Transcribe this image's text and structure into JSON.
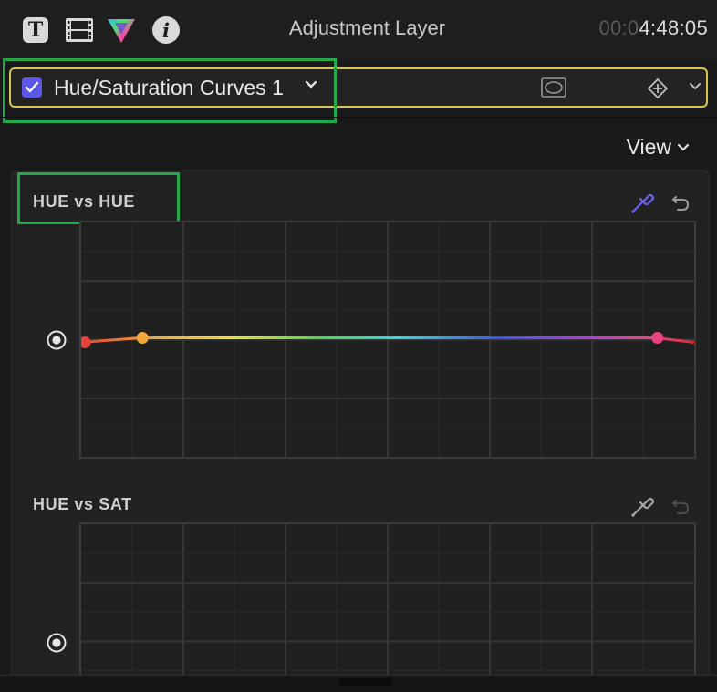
{
  "toolbar": {
    "icons": [
      "text-inspector-icon",
      "video-inspector-icon",
      "color-inspector-icon",
      "info-inspector-icon"
    ],
    "text_icon_glyph": "T",
    "info_icon_glyph": "i",
    "title": "Adjustment Layer",
    "timecode_dim": "00:0",
    "timecode_bright": "4:48:05"
  },
  "effect": {
    "enabled": true,
    "name": "Hue/Saturation Curves 1",
    "check_color": "#5b57e8",
    "bar_border_color": "#d9c24a"
  },
  "highlight_color": "#23a84a",
  "view_menu": {
    "label": "View"
  },
  "curves": [
    {
      "title": "HUE vs HUE",
      "eyedropper_active": true,
      "undo_enabled": true
    },
    {
      "title": "HUE vs SAT",
      "eyedropper_active": false,
      "undo_enabled": false
    }
  ],
  "hue_vs_hue_points": [
    {
      "hue": 0,
      "color": "#e8433a"
    },
    {
      "hue": 0.1,
      "color": "#f0a63b"
    },
    {
      "hue": 0.94,
      "color": "#e8447f"
    }
  ]
}
